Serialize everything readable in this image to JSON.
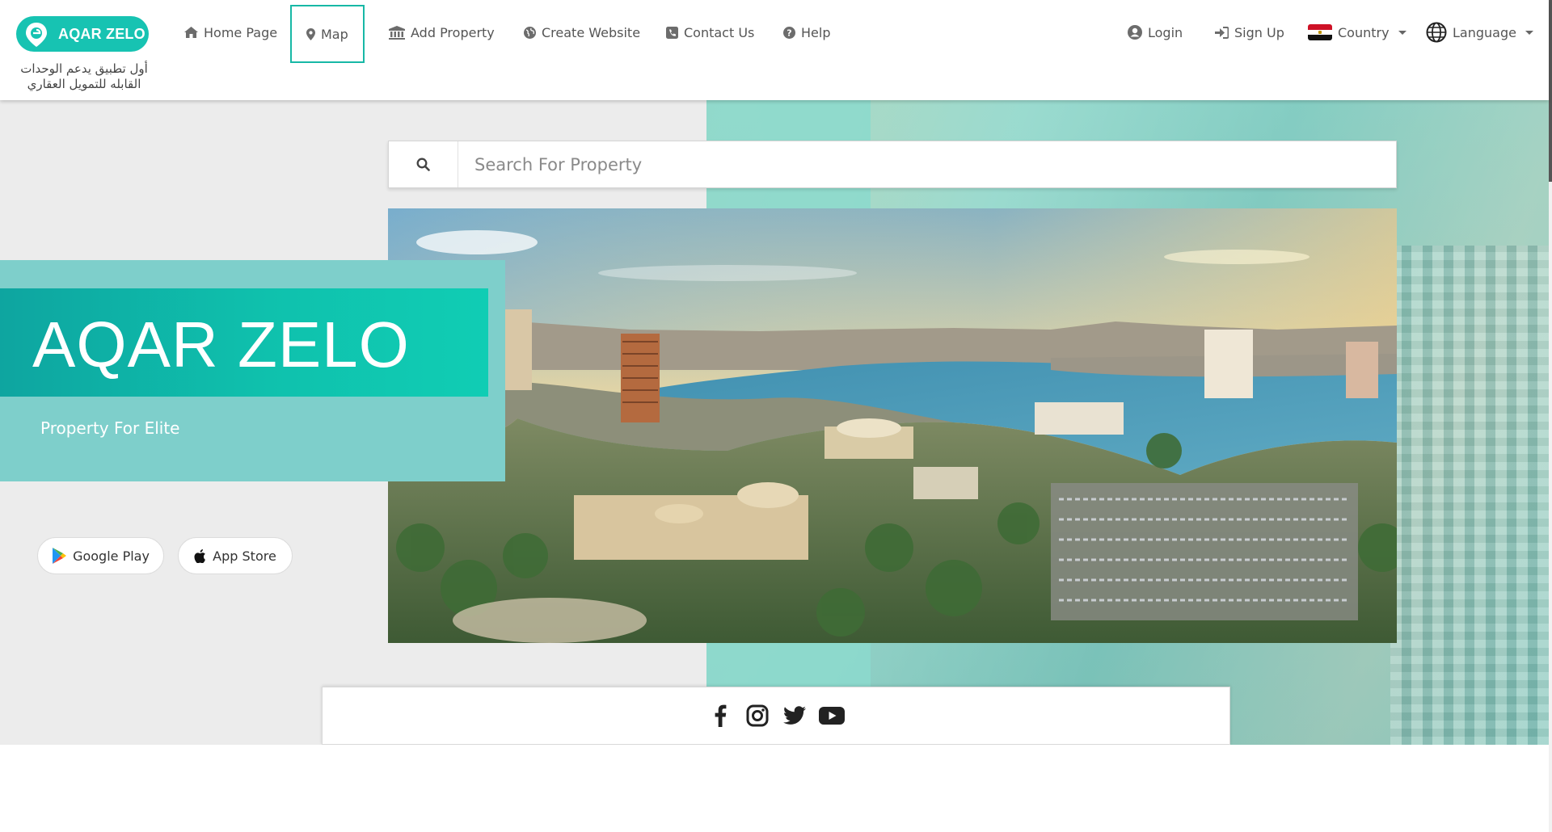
{
  "brand": {
    "logo_text": "AQAR ZELO",
    "tagline_line1": "أول تطبيق يدعم الوحدات",
    "tagline_line2": "القابله للتمويل العقاري",
    "accent_color": "#17c3b2"
  },
  "nav": {
    "items": [
      {
        "label": "Home Page",
        "icon": "home-icon"
      },
      {
        "label": "Map",
        "icon": "map-marker-icon",
        "active": true
      },
      {
        "label": "Add Property",
        "icon": "bank-icon"
      },
      {
        "label": "Create Website",
        "icon": "globe-icon"
      },
      {
        "label": "Contact Us",
        "icon": "phone-icon"
      },
      {
        "label": "Help",
        "icon": "question-circle-icon"
      }
    ],
    "right": {
      "login": "Login",
      "signup": "Sign Up",
      "country": "Country",
      "language": "Language"
    }
  },
  "search": {
    "placeholder": "Search For Property",
    "value": ""
  },
  "hero": {
    "title": "AQAR ZELO",
    "subtitle": "Property For Elite",
    "google_play": "Google Play",
    "app_store": "App Store"
  },
  "social": {
    "icons": [
      "facebook-icon",
      "instagram-icon",
      "twitter-icon",
      "youtube-icon"
    ]
  }
}
